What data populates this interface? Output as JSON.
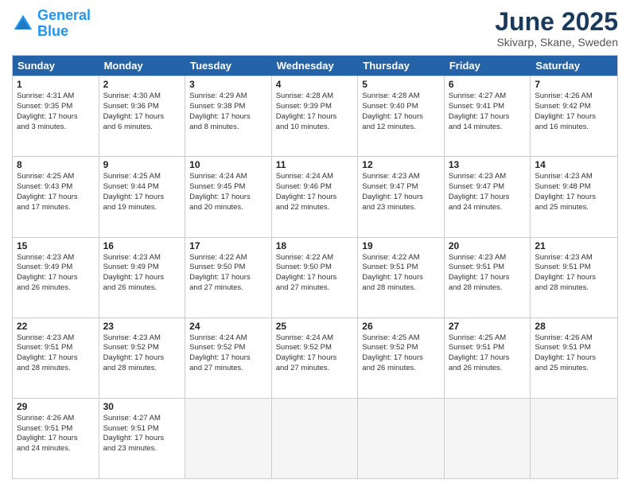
{
  "logo": {
    "text_general": "General",
    "text_blue": "Blue"
  },
  "title": "June 2025",
  "location": "Skivarp, Skane, Sweden",
  "header_days": [
    "Sunday",
    "Monday",
    "Tuesday",
    "Wednesday",
    "Thursday",
    "Friday",
    "Saturday"
  ],
  "weeks": [
    [
      {
        "day": "1",
        "lines": [
          "Sunrise: 4:31 AM",
          "Sunset: 9:35 PM",
          "Daylight: 17 hours",
          "and 3 minutes."
        ]
      },
      {
        "day": "2",
        "lines": [
          "Sunrise: 4:30 AM",
          "Sunset: 9:36 PM",
          "Daylight: 17 hours",
          "and 6 minutes."
        ]
      },
      {
        "day": "3",
        "lines": [
          "Sunrise: 4:29 AM",
          "Sunset: 9:38 PM",
          "Daylight: 17 hours",
          "and 8 minutes."
        ]
      },
      {
        "day": "4",
        "lines": [
          "Sunrise: 4:28 AM",
          "Sunset: 9:39 PM",
          "Daylight: 17 hours",
          "and 10 minutes."
        ]
      },
      {
        "day": "5",
        "lines": [
          "Sunrise: 4:28 AM",
          "Sunset: 9:40 PM",
          "Daylight: 17 hours",
          "and 12 minutes."
        ]
      },
      {
        "day": "6",
        "lines": [
          "Sunrise: 4:27 AM",
          "Sunset: 9:41 PM",
          "Daylight: 17 hours",
          "and 14 minutes."
        ]
      },
      {
        "day": "7",
        "lines": [
          "Sunrise: 4:26 AM",
          "Sunset: 9:42 PM",
          "Daylight: 17 hours",
          "and 16 minutes."
        ]
      }
    ],
    [
      {
        "day": "8",
        "lines": [
          "Sunrise: 4:25 AM",
          "Sunset: 9:43 PM",
          "Daylight: 17 hours",
          "and 17 minutes."
        ]
      },
      {
        "day": "9",
        "lines": [
          "Sunrise: 4:25 AM",
          "Sunset: 9:44 PM",
          "Daylight: 17 hours",
          "and 19 minutes."
        ]
      },
      {
        "day": "10",
        "lines": [
          "Sunrise: 4:24 AM",
          "Sunset: 9:45 PM",
          "Daylight: 17 hours",
          "and 20 minutes."
        ]
      },
      {
        "day": "11",
        "lines": [
          "Sunrise: 4:24 AM",
          "Sunset: 9:46 PM",
          "Daylight: 17 hours",
          "and 22 minutes."
        ]
      },
      {
        "day": "12",
        "lines": [
          "Sunrise: 4:23 AM",
          "Sunset: 9:47 PM",
          "Daylight: 17 hours",
          "and 23 minutes."
        ]
      },
      {
        "day": "13",
        "lines": [
          "Sunrise: 4:23 AM",
          "Sunset: 9:47 PM",
          "Daylight: 17 hours",
          "and 24 minutes."
        ]
      },
      {
        "day": "14",
        "lines": [
          "Sunrise: 4:23 AM",
          "Sunset: 9:48 PM",
          "Daylight: 17 hours",
          "and 25 minutes."
        ]
      }
    ],
    [
      {
        "day": "15",
        "lines": [
          "Sunrise: 4:23 AM",
          "Sunset: 9:49 PM",
          "Daylight: 17 hours",
          "and 26 minutes."
        ]
      },
      {
        "day": "16",
        "lines": [
          "Sunrise: 4:23 AM",
          "Sunset: 9:49 PM",
          "Daylight: 17 hours",
          "and 26 minutes."
        ]
      },
      {
        "day": "17",
        "lines": [
          "Sunrise: 4:22 AM",
          "Sunset: 9:50 PM",
          "Daylight: 17 hours",
          "and 27 minutes."
        ]
      },
      {
        "day": "18",
        "lines": [
          "Sunrise: 4:22 AM",
          "Sunset: 9:50 PM",
          "Daylight: 17 hours",
          "and 27 minutes."
        ]
      },
      {
        "day": "19",
        "lines": [
          "Sunrise: 4:22 AM",
          "Sunset: 9:51 PM",
          "Daylight: 17 hours",
          "and 28 minutes."
        ]
      },
      {
        "day": "20",
        "lines": [
          "Sunrise: 4:23 AM",
          "Sunset: 9:51 PM",
          "Daylight: 17 hours",
          "and 28 minutes."
        ]
      },
      {
        "day": "21",
        "lines": [
          "Sunrise: 4:23 AM",
          "Sunset: 9:51 PM",
          "Daylight: 17 hours",
          "and 28 minutes."
        ]
      }
    ],
    [
      {
        "day": "22",
        "lines": [
          "Sunrise: 4:23 AM",
          "Sunset: 9:51 PM",
          "Daylight: 17 hours",
          "and 28 minutes."
        ]
      },
      {
        "day": "23",
        "lines": [
          "Sunrise: 4:23 AM",
          "Sunset: 9:52 PM",
          "Daylight: 17 hours",
          "and 28 minutes."
        ]
      },
      {
        "day": "24",
        "lines": [
          "Sunrise: 4:24 AM",
          "Sunset: 9:52 PM",
          "Daylight: 17 hours",
          "and 27 minutes."
        ]
      },
      {
        "day": "25",
        "lines": [
          "Sunrise: 4:24 AM",
          "Sunset: 9:52 PM",
          "Daylight: 17 hours",
          "and 27 minutes."
        ]
      },
      {
        "day": "26",
        "lines": [
          "Sunrise: 4:25 AM",
          "Sunset: 9:52 PM",
          "Daylight: 17 hours",
          "and 26 minutes."
        ]
      },
      {
        "day": "27",
        "lines": [
          "Sunrise: 4:25 AM",
          "Sunset: 9:51 PM",
          "Daylight: 17 hours",
          "and 26 minutes."
        ]
      },
      {
        "day": "28",
        "lines": [
          "Sunrise: 4:26 AM",
          "Sunset: 9:51 PM",
          "Daylight: 17 hours",
          "and 25 minutes."
        ]
      }
    ],
    [
      {
        "day": "29",
        "lines": [
          "Sunrise: 4:26 AM",
          "Sunset: 9:51 PM",
          "Daylight: 17 hours",
          "and 24 minutes."
        ]
      },
      {
        "day": "30",
        "lines": [
          "Sunrise: 4:27 AM",
          "Sunset: 9:51 PM",
          "Daylight: 17 hours",
          "and 23 minutes."
        ]
      },
      {
        "day": "",
        "lines": []
      },
      {
        "day": "",
        "lines": []
      },
      {
        "day": "",
        "lines": []
      },
      {
        "day": "",
        "lines": []
      },
      {
        "day": "",
        "lines": []
      }
    ]
  ]
}
